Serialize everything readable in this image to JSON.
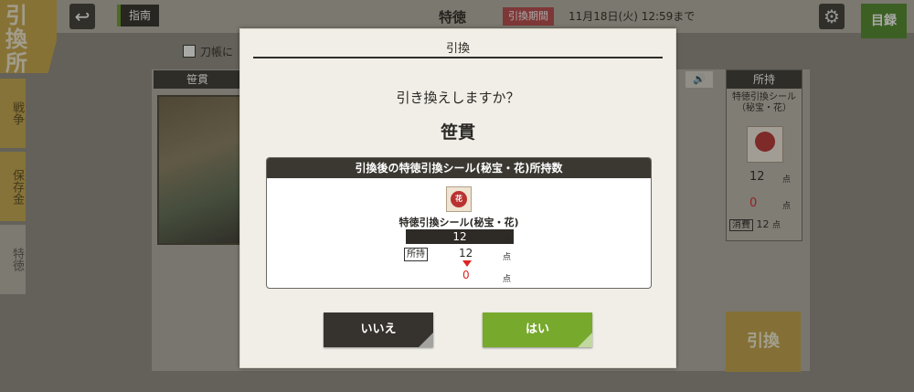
{
  "app": {
    "section_title": "引換所",
    "back_icon": "back-arrow-icon",
    "guide_label": "指南",
    "page_title": "特徳",
    "period_label": "引換期間",
    "period_text": "11月18日(火) 12:59まで",
    "catalog_label": "目録",
    "settings_icon": "gear-icon"
  },
  "sidebar": {
    "tabs": [
      {
        "label": "戦争"
      },
      {
        "label": "保存金"
      },
      {
        "label": "特徳"
      }
    ]
  },
  "filter": {
    "checkbox_label": "刀帳に"
  },
  "card": {
    "header": "笹貫"
  },
  "owned": {
    "header": "所持",
    "item_name": "特徳引換シール（秘宝・花）",
    "current": "12",
    "after": "0",
    "unit": "点",
    "consume_label": "消費",
    "consume_value": "12"
  },
  "exchange_button": "引換",
  "modal": {
    "title": "引換",
    "question": "引き換えしますか？",
    "target": "笹貫",
    "info_header": "引換後の特徳引換シール(秘宝・花)所持数",
    "item_name": "特徳引換シール(秘宝・花)",
    "cost": "12",
    "held_label": "所持",
    "held_value": "12",
    "after_value": "0",
    "unit": "点",
    "no_label": "いいえ",
    "yes_label": "はい"
  },
  "colors": {
    "accent_gold": "#c7a84e",
    "yes_green": "#77a92c",
    "no_dark": "#36332e",
    "decrease_red": "#e02424"
  }
}
